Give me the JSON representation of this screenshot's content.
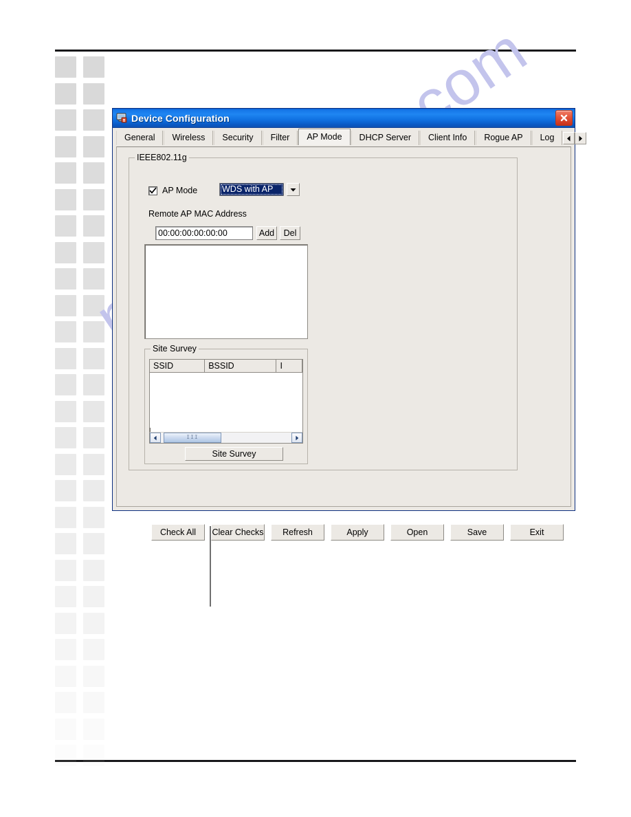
{
  "window": {
    "title": "Device Configuration",
    "icon": "device-config-icon",
    "close_label": "close-icon"
  },
  "tabs": [
    {
      "label": "General",
      "active": false
    },
    {
      "label": "Wireless",
      "active": false
    },
    {
      "label": "Security",
      "active": false
    },
    {
      "label": "Filter",
      "active": false
    },
    {
      "label": "AP Mode",
      "active": true
    },
    {
      "label": "DHCP Server",
      "active": false
    },
    {
      "label": "Client Info",
      "active": false
    },
    {
      "label": "Rogue AP",
      "active": false
    },
    {
      "label": "Log",
      "active": false
    }
  ],
  "tab_scroll": {
    "prev": "◄",
    "next": "►"
  },
  "ap_mode_panel": {
    "group_title": "IEEE802.11g",
    "checkbox": {
      "label": "AP Mode",
      "checked": true,
      "mark": "✓"
    },
    "mode_select": {
      "value": "WDS with AP",
      "arrow": "▼"
    },
    "mac_section": {
      "label": "Remote AP MAC Address",
      "input_value": "00:00:00:00:00:00",
      "input_placeholder": "00:00:00:00:00:00",
      "add_label": "Add",
      "del_label": "Del"
    },
    "site_survey": {
      "group_title": "Site Survey",
      "columns": [
        "SSID",
        "BSSID",
        "I"
      ],
      "rows": [],
      "scroll_left": "◄",
      "scroll_right": "►",
      "thumb_grip": "III",
      "button_label": "Site  Survey"
    }
  },
  "bottom_buttons": [
    {
      "label": "Check All"
    },
    {
      "label": "Clear Checks"
    },
    {
      "label": "Refresh"
    },
    {
      "label": "Apply"
    },
    {
      "label": "Open"
    },
    {
      "label": "Save"
    },
    {
      "label": "Exit"
    }
  ],
  "page": {
    "watermark": "manualshive.com"
  },
  "colors": {
    "titlebar_blue": "#1677e8",
    "selection_blue": "#0a246a",
    "close_red": "#c8301a",
    "dialog_face": "#ece9e4",
    "watermark": "#c3c4ec"
  }
}
